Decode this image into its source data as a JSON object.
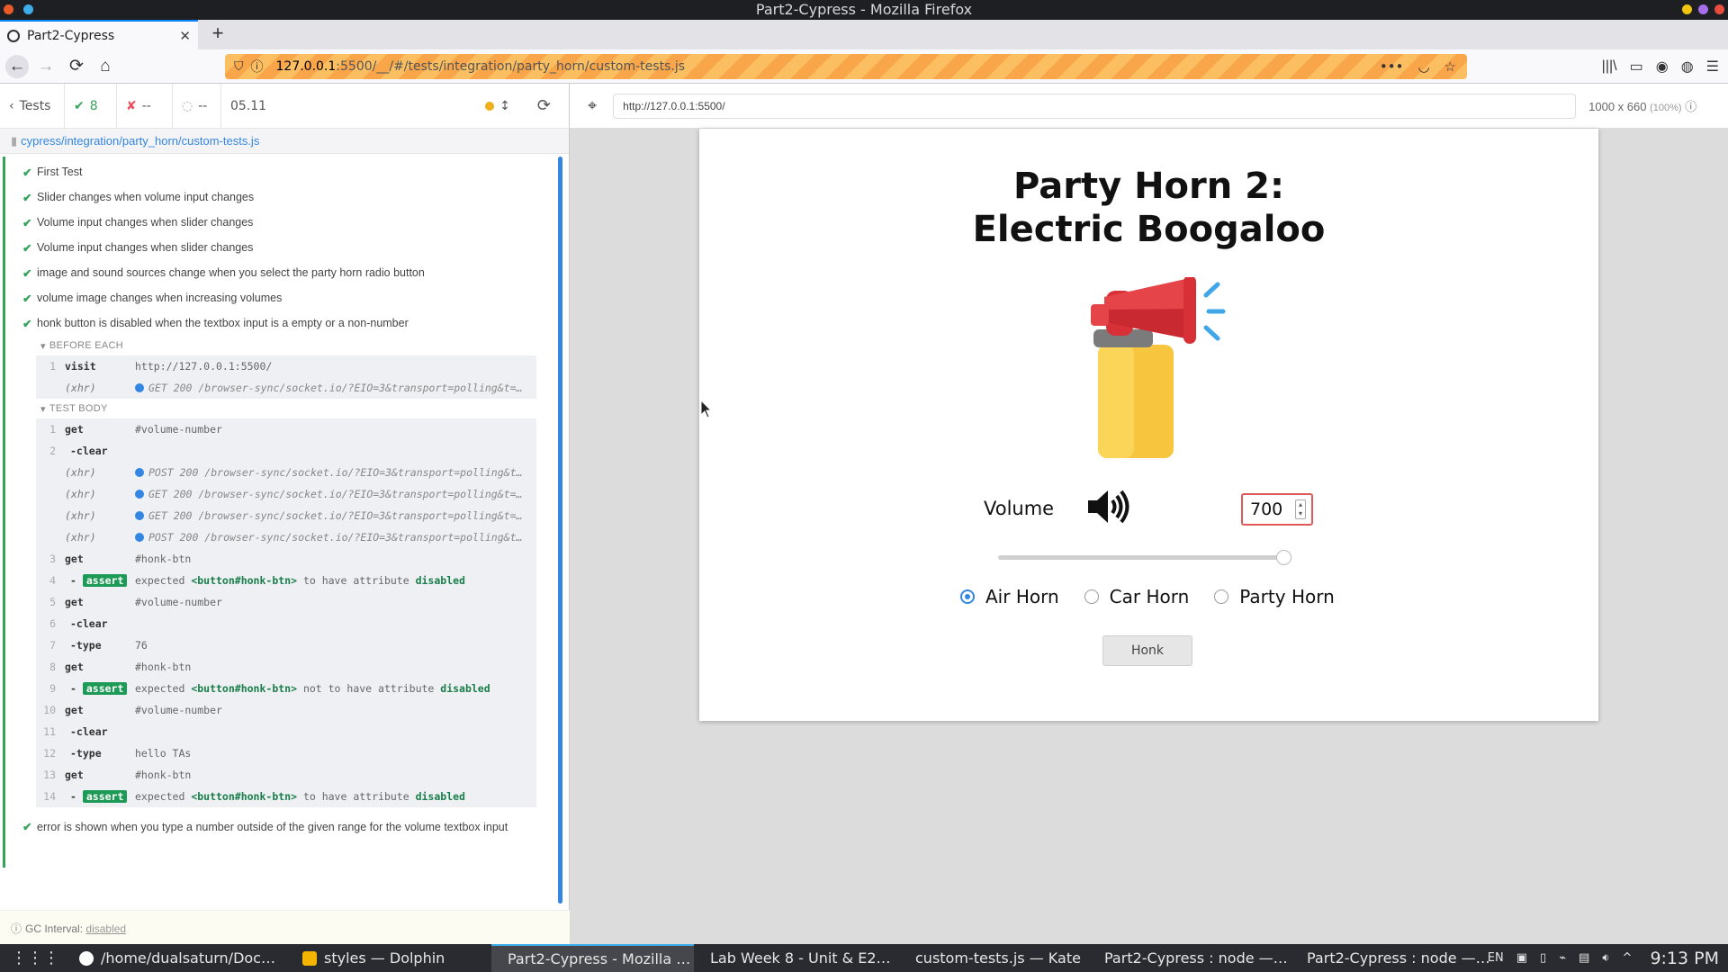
{
  "window": {
    "title": "Part2-Cypress - Mozilla Firefox"
  },
  "browser": {
    "tab_title": "Part2-Cypress",
    "url_host": "127.0.0.1",
    "url_path": ":5500/__/#/tests/integration/party_horn/custom-tests.js"
  },
  "reporter": {
    "tests_label": "Tests",
    "passed": "8",
    "failed": "--",
    "pending": "--",
    "duration": "05.11",
    "spec_path": "cypress/integration/party_horn/custom-tests.js",
    "tests": [
      "First Test",
      "Slider changes when volume input changes",
      "Volume input changes when slider changes",
      "Volume input changes when slider changes",
      "image and sound sources change when you select the party horn radio button",
      "volume image changes when increasing volumes",
      "honk button is disabled when the textbox input is a empty or a non-number"
    ],
    "last_test": "error is shown when you type a number outside of the given range for the volume textbox input",
    "before_each_label": "BEFORE EACH",
    "before_each": [
      {
        "num": "1",
        "name": "visit",
        "msg": "http://127.0.0.1:5500/"
      },
      {
        "num": "",
        "name": "(xhr)",
        "msg": "GET 200 /browser-sync/socket.io/?EIO=3&transport=polling&t=…"
      }
    ],
    "test_body_label": "TEST BODY",
    "body": [
      {
        "num": "1",
        "name": "get",
        "msg": "#volume-number"
      },
      {
        "num": "2",
        "name": "-clear",
        "msg": ""
      },
      {
        "num": "",
        "name": "(xhr)",
        "msg": "POST 200 /browser-sync/socket.io/?EIO=3&transport=polling&t…"
      },
      {
        "num": "",
        "name": "(xhr)",
        "msg": "GET 200 /browser-sync/socket.io/?EIO=3&transport=polling&t=…"
      },
      {
        "num": "",
        "name": "(xhr)",
        "msg": "GET 200 /browser-sync/socket.io/?EIO=3&transport=polling&t=…"
      },
      {
        "num": "",
        "name": "(xhr)",
        "msg": "POST 200 /browser-sync/socket.io/?EIO=3&transport=polling&t…"
      },
      {
        "num": "3",
        "name": "get",
        "msg": "#honk-btn"
      },
      {
        "num": "4",
        "name": "assert",
        "msg": "expected <button#honk-btn> to have attribute disabled"
      },
      {
        "num": "5",
        "name": "get",
        "msg": "#volume-number"
      },
      {
        "num": "6",
        "name": "-clear",
        "msg": ""
      },
      {
        "num": "7",
        "name": "-type",
        "msg": "76"
      },
      {
        "num": "8",
        "name": "get",
        "msg": "#honk-btn"
      },
      {
        "num": "9",
        "name": "assert",
        "msg": "expected <button#honk-btn> not to have attribute disabled"
      },
      {
        "num": "10",
        "name": "get",
        "msg": "#volume-number"
      },
      {
        "num": "11",
        "name": "-clear",
        "msg": ""
      },
      {
        "num": "12",
        "name": "-type",
        "msg": "hello TAs"
      },
      {
        "num": "13",
        "name": "get",
        "msg": "#honk-btn"
      },
      {
        "num": "14",
        "name": "assert",
        "msg": "expected <button#honk-btn> to have attribute disabled"
      }
    ],
    "gc_label": "GC Interval:",
    "gc_value": "disabled"
  },
  "aut": {
    "url": "http://127.0.0.1:5500/",
    "viewport": "1000 x 660",
    "scale": "(100%)"
  },
  "app": {
    "title_line1": "Party Horn 2:",
    "title_line2": "Electric Boogaloo",
    "volume_label": "Volume",
    "volume_value": "700",
    "slider_level": 1.0,
    "radios": [
      "Air Horn",
      "Car Horn",
      "Party Horn"
    ],
    "selected_radio": "Air Horn",
    "honk_label": "Honk"
  },
  "taskbar": {
    "tasks": [
      "/home/dualsaturn/Doc…",
      "styles — Dolphin",
      "Part2-Cypress - Mozilla …",
      "Lab Week 8 - Unit & E2…",
      "custom-tests.js — Kate",
      "Part2-Cypress : node —…",
      "Part2-Cypress : node —…"
    ],
    "lang": "EN",
    "clock": "9:13 PM"
  },
  "colors": {
    "accent": "#3486e3",
    "pass": "#35a35a",
    "fail": "#e94f5f"
  }
}
